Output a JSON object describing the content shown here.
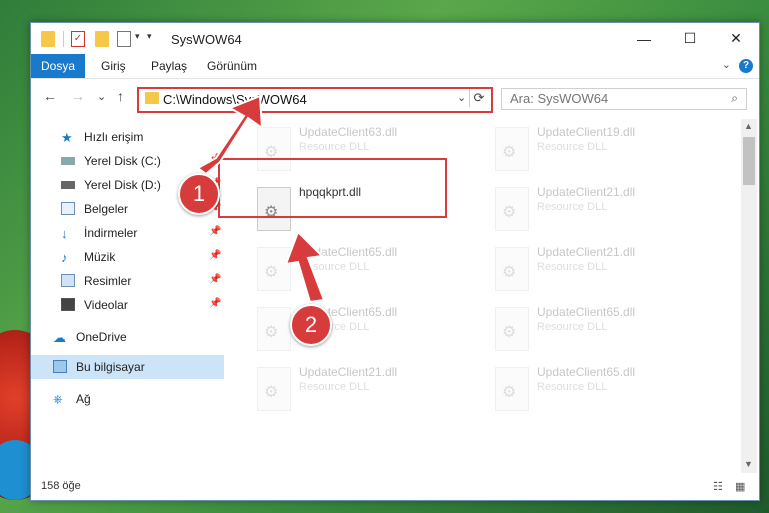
{
  "window": {
    "title": "SysWOW64",
    "minimize": "—",
    "maximize": "☐",
    "close": "✕"
  },
  "ribbon": {
    "tabs": [
      {
        "label": "Dosya",
        "active": true
      },
      {
        "label": "Giriş"
      },
      {
        "label": "Paylaş"
      },
      {
        "label": "Görünüm"
      }
    ],
    "help": "?"
  },
  "nav": {
    "back": "←",
    "forward": "→",
    "recent": "⌄",
    "up": "↑",
    "address": "C:\\Windows\\SysWOW64",
    "search_placeholder": "Ara: SysWOW64"
  },
  "sidebar": {
    "items": [
      {
        "label": "Hızlı erişim",
        "icon": "star-icon"
      },
      {
        "label": "Yerel Disk (C:)",
        "icon": "drive-icon",
        "pinned": true
      },
      {
        "label": "Yerel Disk (D:)",
        "icon": "drive-icon",
        "pinned": true
      },
      {
        "label": "Belgeler",
        "icon": "documents-icon",
        "pinned": true
      },
      {
        "label": "İndirmeler",
        "icon": "download-icon",
        "pinned": true
      },
      {
        "label": "Müzik",
        "icon": "music-icon",
        "pinned": true
      },
      {
        "label": "Resimler",
        "icon": "pictures-icon",
        "pinned": true
      },
      {
        "label": "Videolar",
        "icon": "video-icon",
        "pinned": true
      },
      {
        "label": "OneDrive",
        "icon": "cloud-icon"
      },
      {
        "label": "Bu bilgisayar",
        "icon": "computer-icon",
        "selected": true
      },
      {
        "label": "Ağ",
        "icon": "network-icon"
      }
    ]
  },
  "files": {
    "left": [
      {
        "name": "UpdateClient63.dll",
        "desc": "Resource DLL"
      },
      {
        "name": "hpqqkprt.dll",
        "desc": ""
      },
      {
        "name": "UpdateClient65.dll",
        "desc": "Resource DLL"
      },
      {
        "name": "UpdateClient65.dll",
        "desc": "Resource DLL"
      },
      {
        "name": "UpdateClient21.dll",
        "desc": "Resource DLL"
      }
    ],
    "right": [
      {
        "name": "UpdateClient19.dll",
        "desc": "Resource DLL"
      },
      {
        "name": "UpdateClient21.dll",
        "desc": "Resource DLL"
      },
      {
        "name": "UpdateClient21.dll",
        "desc": "Resource DLL"
      },
      {
        "name": "UpdateClient65.dll",
        "desc": "Resource DLL"
      },
      {
        "name": "UpdateClient65.dll",
        "desc": "Resource DLL"
      }
    ]
  },
  "status": {
    "count": "158 öğe"
  },
  "annotations": {
    "step1": "1",
    "step2": "2",
    "color": "#d83b3b"
  }
}
